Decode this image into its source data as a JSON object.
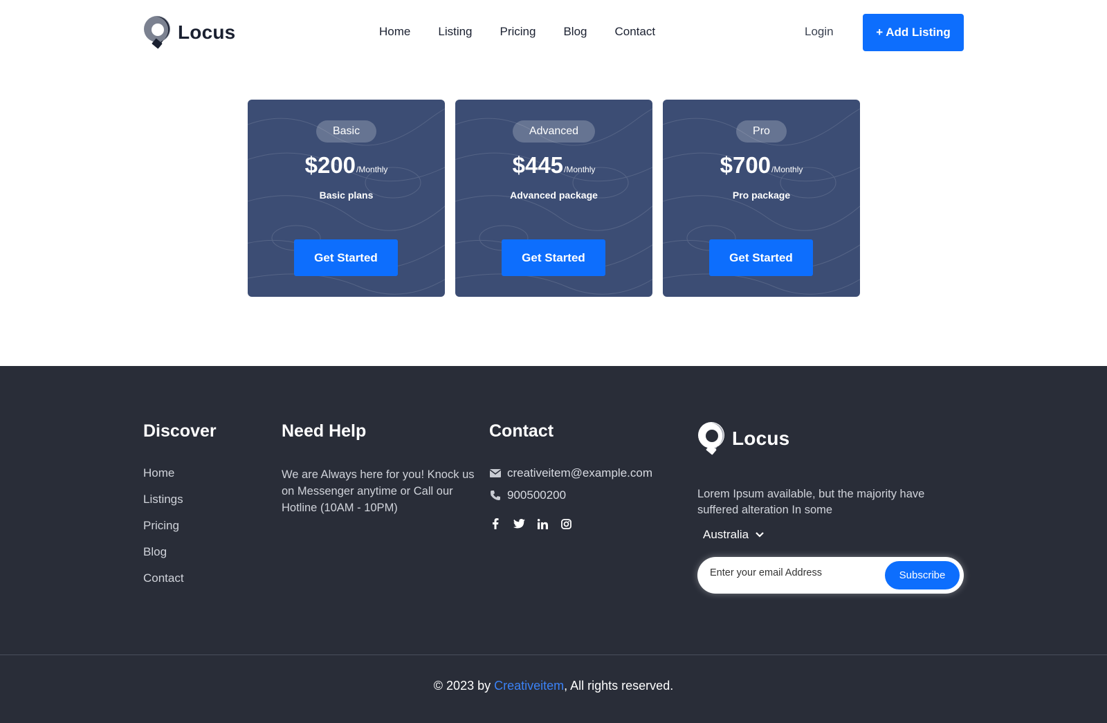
{
  "brand": {
    "name": "Locus",
    "logo_icon": "map-pin-icon"
  },
  "nav": {
    "items": [
      "Home",
      "Listing",
      "Pricing",
      "Blog",
      "Contact"
    ],
    "login": "Login",
    "add_listing": "+ Add Listing"
  },
  "plans": [
    {
      "badge": "Basic",
      "price": "$200",
      "period": "/Monthly",
      "description": "Basic plans",
      "cta": "Get Started"
    },
    {
      "badge": "Advanced",
      "price": "$445",
      "period": "/Monthly",
      "description": "Advanced package",
      "cta": "Get Started"
    },
    {
      "badge": "Pro",
      "price": "$700",
      "period": "/Monthly",
      "description": "Pro package",
      "cta": "Get Started"
    }
  ],
  "footer": {
    "discover": {
      "title": "Discover",
      "links": [
        "Home",
        "Listings",
        "Pricing",
        "Blog",
        "Contact"
      ]
    },
    "help": {
      "title": "Need Help",
      "text": "We are Always here for you! Knock us on Messenger anytime or Call our Hotline (10AM - 10PM)"
    },
    "contact": {
      "title": "Contact",
      "email": "creativeitem@example.com",
      "phone": "900500200",
      "email_icon": "envelope-icon",
      "phone_icon": "phone-icon",
      "socials": [
        "facebook-icon",
        "twitter-icon",
        "linkedin-icon",
        "instagram-icon"
      ]
    },
    "about": {
      "brand": "Locus",
      "text": "Lorem Ipsum available, but the majority have suffered alteration In some",
      "country": "Australia",
      "email_placeholder": "Enter your email Address",
      "subscribe": "Subscribe"
    },
    "copyright": {
      "prefix": "© 2023 by ",
      "link": "Creativeitem",
      "suffix": ", All rights reserved."
    }
  },
  "colors": {
    "primary": "#0d6efd",
    "card_bg": "#3c4d74",
    "footer_bg": "#292d38"
  }
}
